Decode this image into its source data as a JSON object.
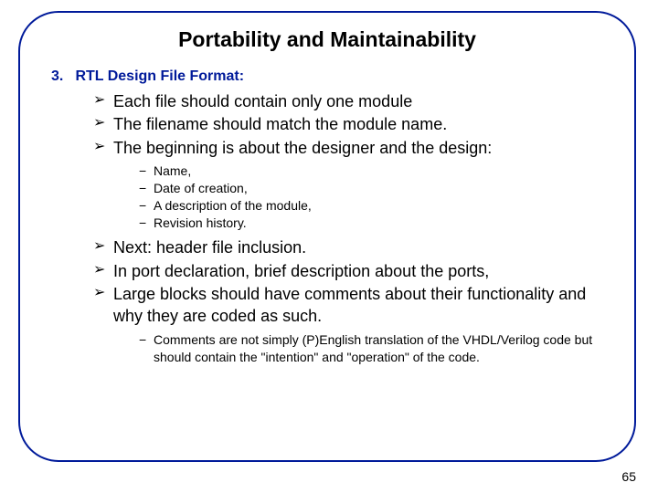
{
  "title": "Portability and Maintainability",
  "section_number": "3.",
  "section_title": "RTL Design File Format:",
  "bullets1": {
    "b0": "Each file should contain only one module",
    "b1": "The filename should match the module name.",
    "b2": "The beginning is about the designer and the design:"
  },
  "sub1": {
    "s0": "Name,",
    "s1": "Date of creation,",
    "s2": "A description of the module,",
    "s3": "Revision history."
  },
  "bullets2": {
    "b0": "Next: header file inclusion.",
    "b1": "In port declaration, brief description about the ports,",
    "b2": "Large blocks should have comments about their functionality and why they are coded as such."
  },
  "sub2": {
    "s0": "Comments are not simply (P)English translation of the VHDL/Verilog code but should contain the \"intention\" and \"operation\" of the code."
  },
  "page_number": "65"
}
